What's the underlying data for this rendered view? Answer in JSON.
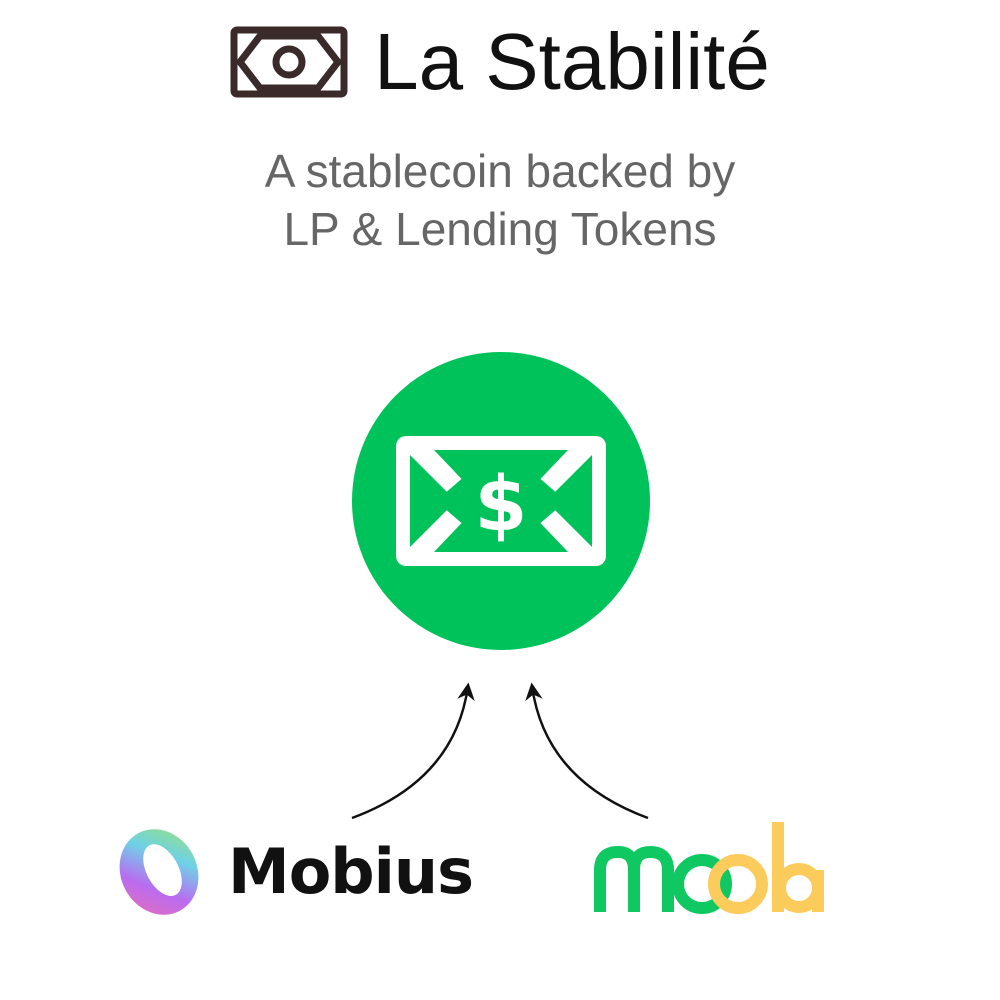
{
  "title": "La Stabilité",
  "subtitle": {
    "line1": "A stablecoin backed by",
    "line2": "LP & Lending Tokens"
  },
  "coin": {
    "symbol": "$",
    "icon": "dollar-bill-icon",
    "color": "#00C25A"
  },
  "title_icon": {
    "icon": "banknote-icon",
    "color": "#3A2A2A"
  },
  "sources": [
    {
      "label": "Mobius",
      "icon": "mobius-logo-icon"
    },
    {
      "label": "moola",
      "icon": "moola-logo-icon",
      "colors": [
        "#10C861",
        "#FBCC5C"
      ]
    }
  ]
}
